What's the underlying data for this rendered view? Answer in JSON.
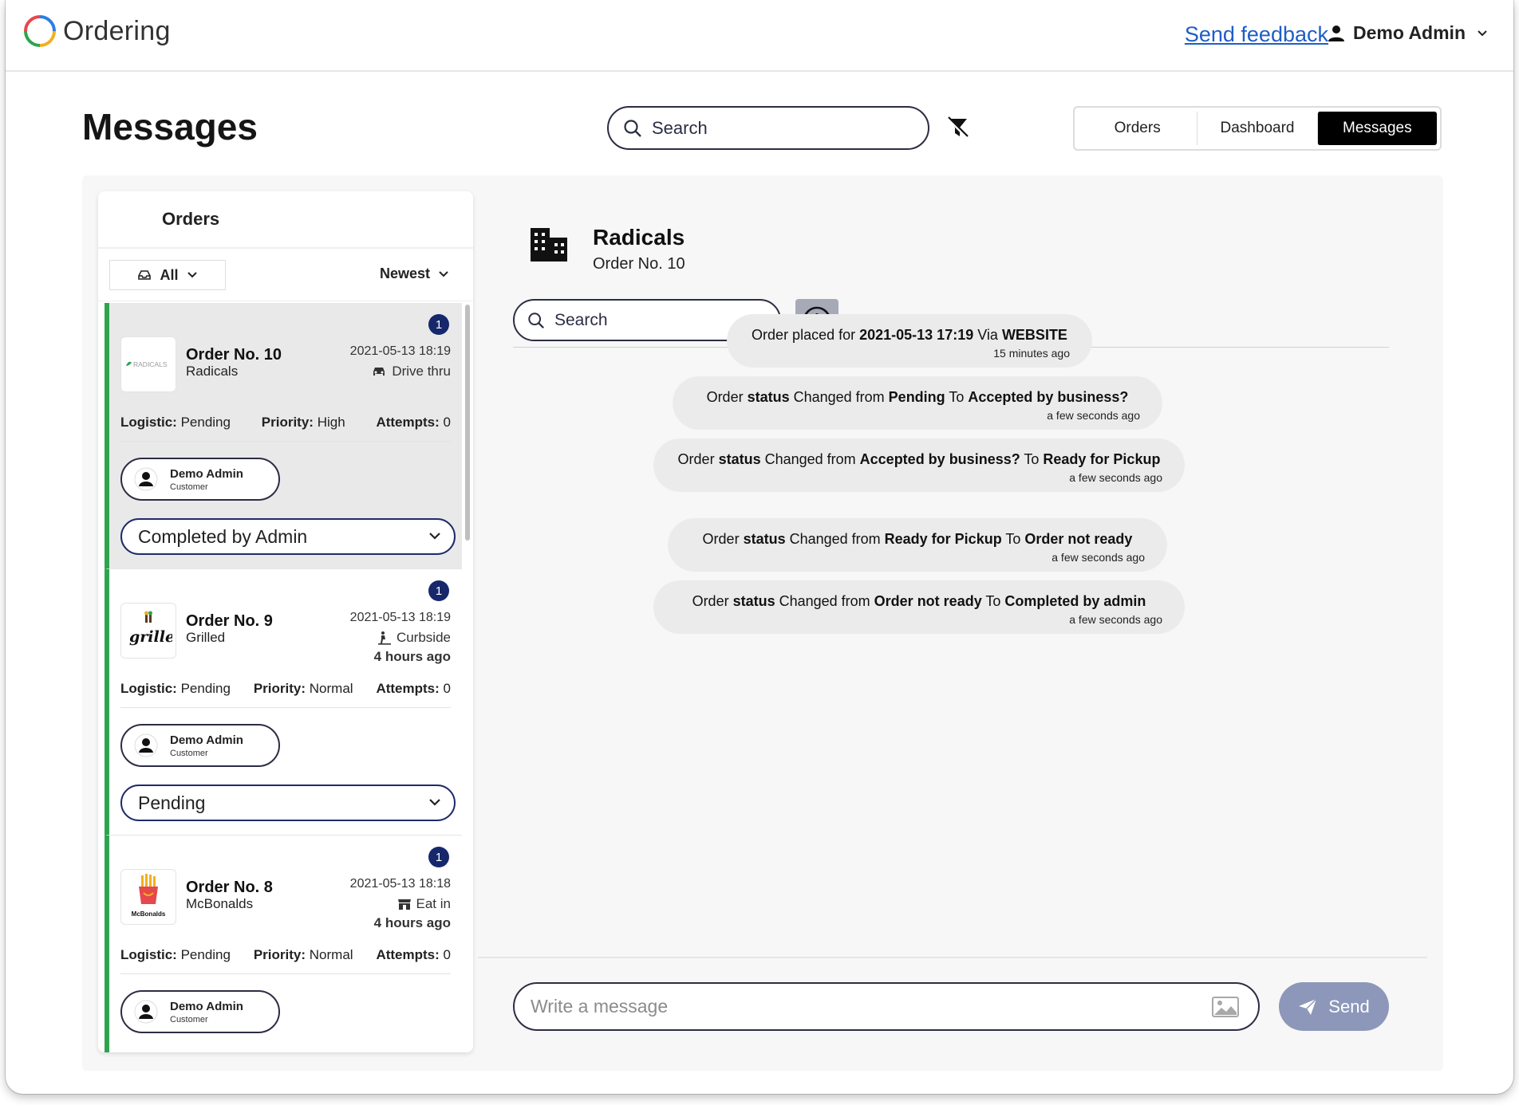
{
  "app": {
    "name": "Ordering"
  },
  "topbar": {
    "feedback_label": "Send feedback",
    "user_name": "Demo Admin"
  },
  "header": {
    "title": "Messages",
    "search_placeholder": "Search",
    "tabs": [
      {
        "label": "Orders",
        "active": false
      },
      {
        "label": "Dashboard",
        "active": false
      },
      {
        "label": "Messages",
        "active": true
      }
    ]
  },
  "orders_panel": {
    "title": "Orders",
    "filter_label": "All",
    "sort_label": "Newest",
    "orders": [
      {
        "name": "Order No. 10",
        "business": "Radicals",
        "logo_text": "RADICALS",
        "date": "2021-05-13 18:19",
        "delivery_type": "Drive thru",
        "time_ago": "",
        "unread": "1",
        "logistic_label": "Logistic:",
        "logistic": "Pending",
        "priority_label": "Priority:",
        "priority": "High",
        "attempts_label": "Attempts:",
        "attempts": "0",
        "customer_name": "Demo Admin",
        "customer_role": "Customer",
        "status": "Completed by Admin",
        "selected": true
      },
      {
        "name": "Order No. 9",
        "business": "Grilled",
        "logo_text": "grilled",
        "date": "2021-05-13 18:19",
        "delivery_type": "Curbside",
        "time_ago": "4 hours ago",
        "unread": "1",
        "logistic_label": "Logistic:",
        "logistic": "Pending",
        "priority_label": "Priority:",
        "priority": "Normal",
        "attempts_label": "Attempts:",
        "attempts": "0",
        "customer_name": "Demo Admin",
        "customer_role": "Customer",
        "status": "Pending",
        "selected": false
      },
      {
        "name": "Order No. 8",
        "business": "McBonalds",
        "logo_text": "McBonalds",
        "date": "2021-05-13 18:18",
        "delivery_type": "Eat in",
        "time_ago": "4 hours ago",
        "unread": "1",
        "logistic_label": "Logistic:",
        "logistic": "Pending",
        "priority_label": "Priority:",
        "priority": "Normal",
        "attempts_label": "Attempts:",
        "attempts": "0",
        "customer_name": "Demo Admin",
        "customer_role": "Customer",
        "status": "",
        "selected": false
      }
    ]
  },
  "chat": {
    "business": "Radicals",
    "order": "Order No. 10",
    "search_placeholder": "Search",
    "messages": [
      {
        "parts": [
          [
            "Order placed for ",
            false
          ],
          [
            "2021-05-13 17:19",
            true
          ],
          [
            " Via ",
            false
          ],
          [
            "WEBSITE",
            true
          ]
        ],
        "time": "15 minutes ago"
      },
      {
        "parts": [
          [
            "Order ",
            false
          ],
          [
            "status",
            true
          ],
          [
            " Changed from ",
            false
          ],
          [
            "Pending",
            true
          ],
          [
            " To ",
            false
          ],
          [
            "Accepted by business?",
            true
          ]
        ],
        "time": "a few seconds ago"
      },
      {
        "parts": [
          [
            "Order ",
            false
          ],
          [
            "status",
            true
          ],
          [
            " Changed from ",
            false
          ],
          [
            "Accepted by business?",
            true
          ],
          [
            " To ",
            false
          ],
          [
            "Ready for Pickup",
            true
          ]
        ],
        "time": "a few seconds ago"
      },
      {
        "parts": [
          [
            "Order ",
            false
          ],
          [
            "status",
            true
          ],
          [
            " Changed from ",
            false
          ],
          [
            "Ready for Pickup",
            true
          ],
          [
            " To ",
            false
          ],
          [
            "Order not ready",
            true
          ]
        ],
        "time": "a few seconds ago"
      },
      {
        "parts": [
          [
            "Order ",
            false
          ],
          [
            "status",
            true
          ],
          [
            " Changed from ",
            false
          ],
          [
            "Order not ready",
            true
          ],
          [
            " To ",
            false
          ],
          [
            "Completed by admin",
            true
          ]
        ],
        "time": "a few seconds ago"
      }
    ],
    "composer_placeholder": "Write a message",
    "send_label": "Send"
  },
  "colors": {
    "accent_green": "#2ea44f",
    "badge_navy": "#16276b",
    "send_button": "#8d97b9",
    "link": "#1f5dc7"
  }
}
